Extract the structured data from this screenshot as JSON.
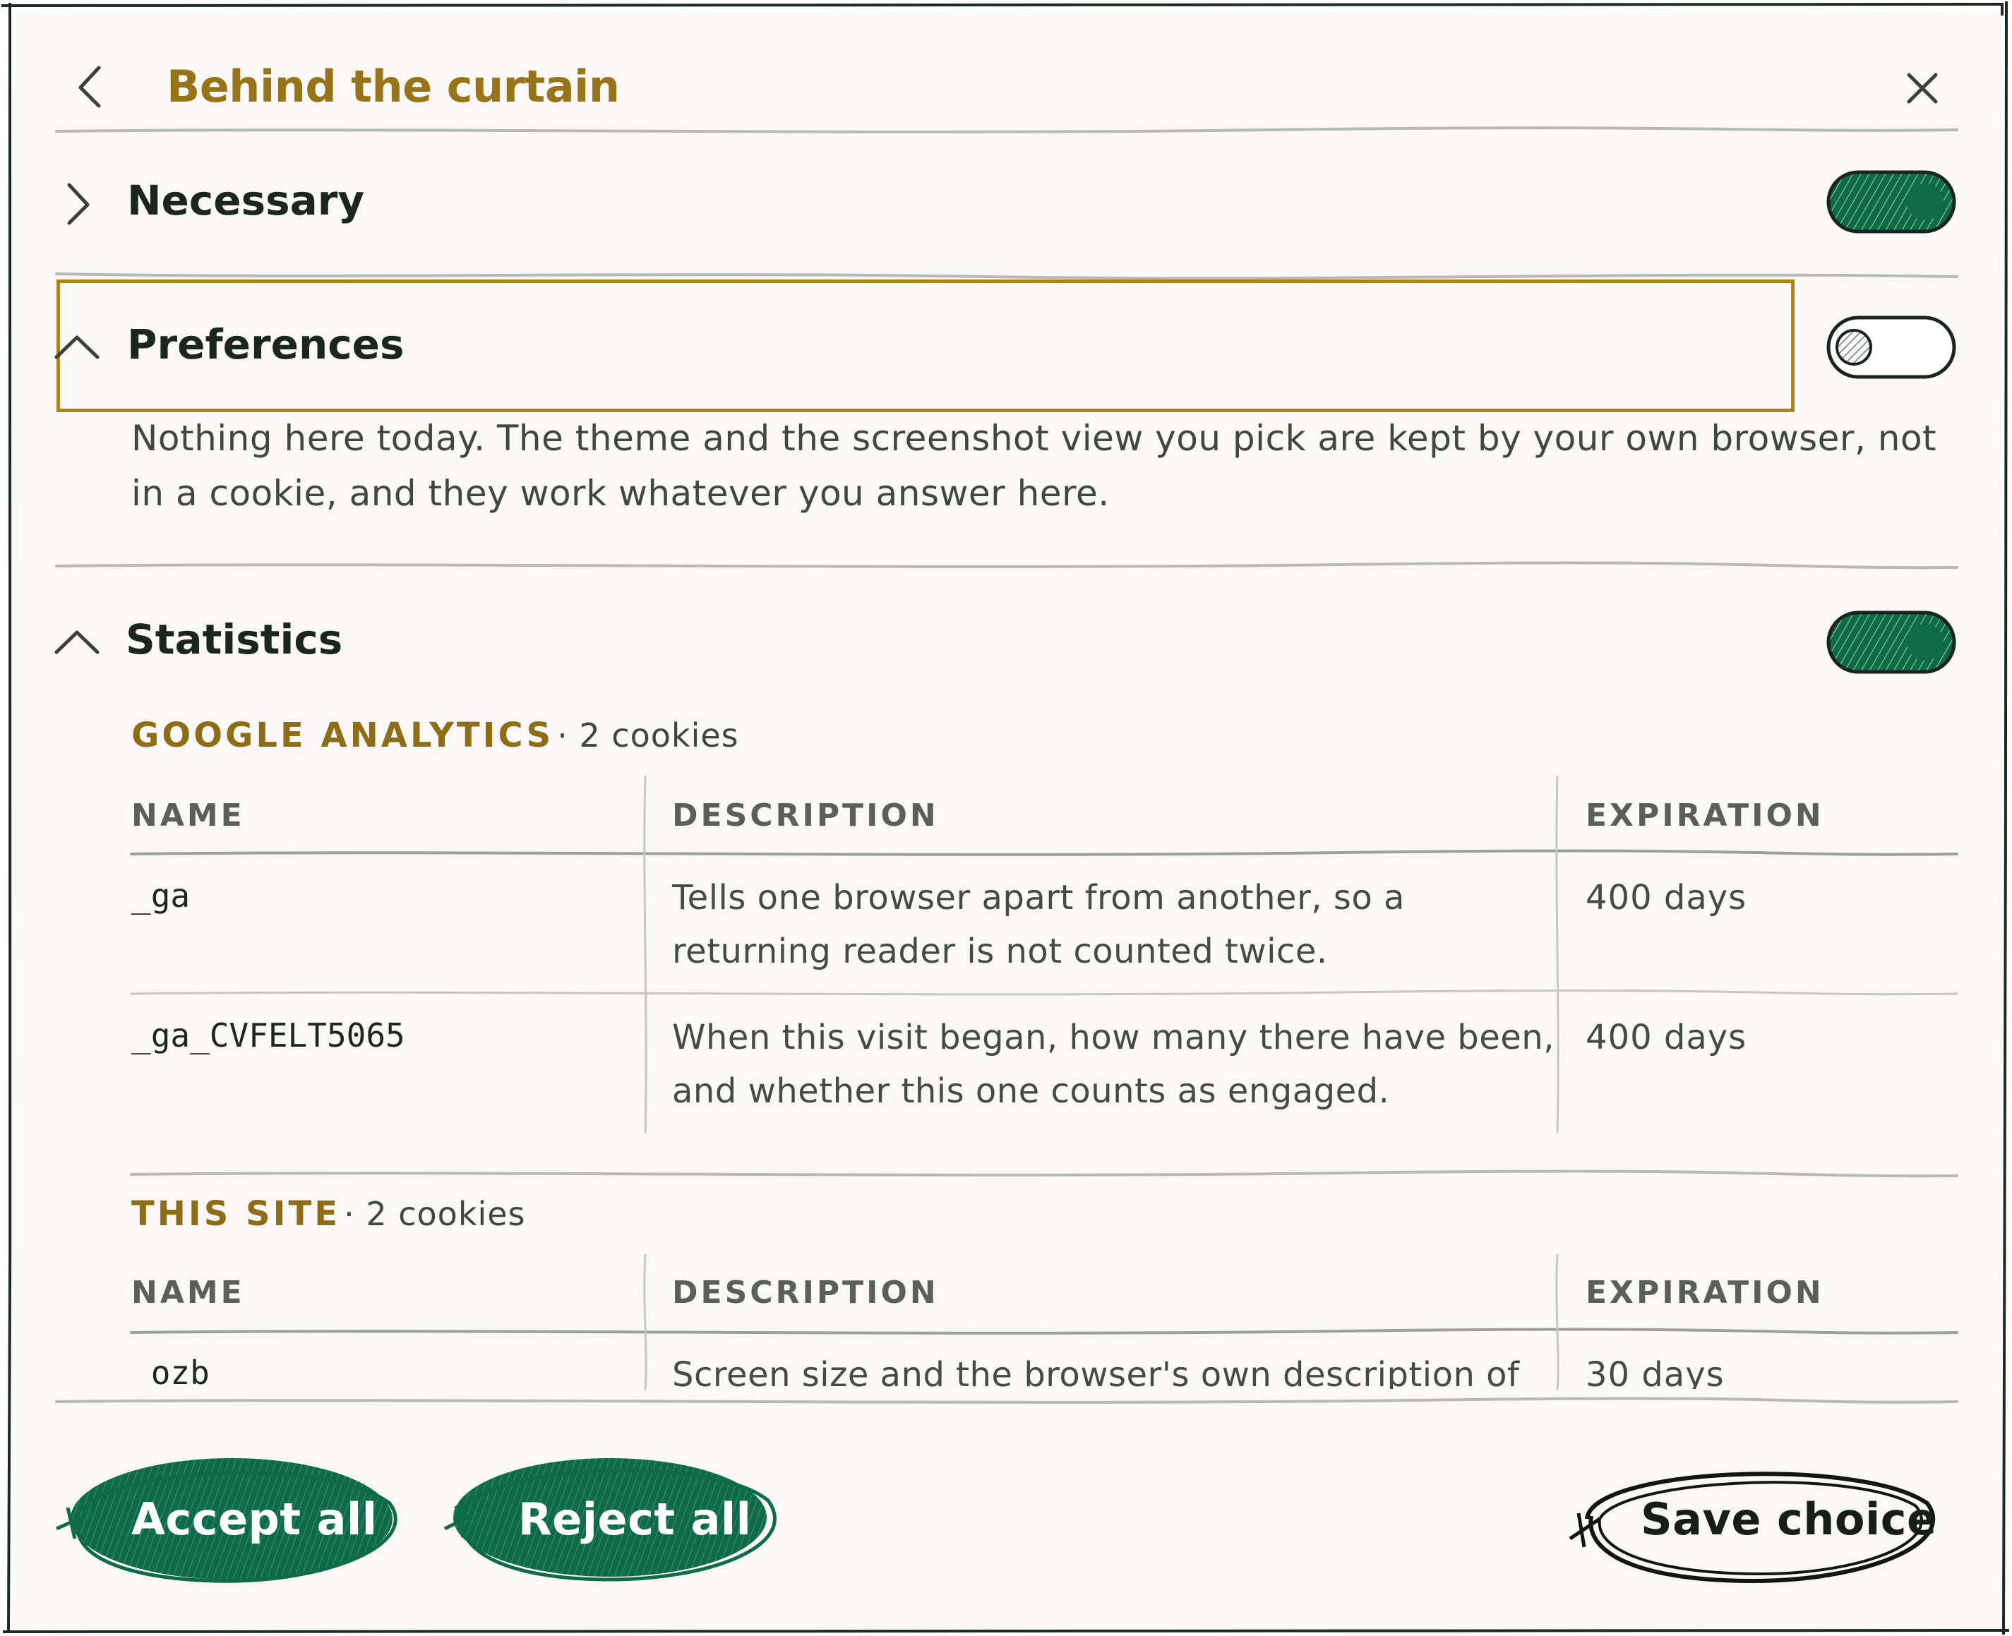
{
  "header": {
    "title": "Behind the curtain"
  },
  "colors": {
    "accent": "#987419",
    "toggle_on": "#0e6b47",
    "button_fill": "#0e6b47",
    "text": "#1c2620"
  },
  "sections": {
    "necessary": {
      "label": "Necessary",
      "toggle_on": true,
      "expanded": false
    },
    "preferences": {
      "label": "Preferences",
      "toggle_on": false,
      "expanded": true,
      "description": "Nothing here today. The theme and the screenshot view you pick are kept by your own browser, not in a cookie, and they work whatever you answer here."
    },
    "statistics": {
      "label": "Statistics",
      "toggle_on": true,
      "expanded": true,
      "groups": [
        {
          "name": "GOOGLE ANALYTICS",
          "count": "· 2 cookies",
          "columns": [
            "NAME",
            "DESCRIPTION",
            "EXPIRATION"
          ],
          "rows": [
            {
              "name": "_ga",
              "desc1": "Tells one browser apart from another, so a",
              "desc2": "returning reader is not counted twice.",
              "expiration": "400 days"
            },
            {
              "name": "_ga_CVFELT5065",
              "desc1": "When this visit began, how many there have been,",
              "desc2": "and whether this one counts as engaged.",
              "expiration": "400 days"
            }
          ]
        },
        {
          "name": "THIS SITE",
          "count": "· 2 cookies",
          "columns": [
            "NAME",
            "DESCRIPTION",
            "EXPIRATION"
          ],
          "rows": [
            {
              "name": "_ozb",
              "desc1": "Screen size and the browser's own description of",
              "expiration": "30 days"
            }
          ]
        }
      ]
    }
  },
  "footer": {
    "accept_all": "Accept all",
    "reject_all": "Reject all",
    "save_choice": "Save choice"
  },
  "icons": [
    "chevron-left-icon",
    "close-icon",
    "chevron-right-icon",
    "chevron-up-icon"
  ]
}
